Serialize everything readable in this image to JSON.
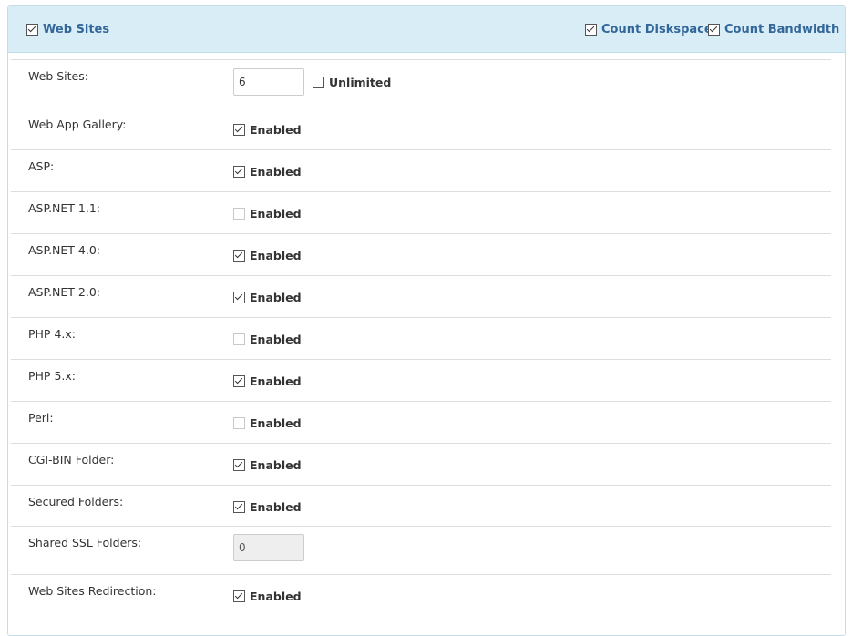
{
  "header": {
    "title": "Web Sites",
    "title_checked": true,
    "count_diskspace": {
      "label": "Count Diskspace",
      "checked": true
    },
    "count_bandwidth": {
      "label": "Count Bandwidth",
      "checked": true
    }
  },
  "web_sites": {
    "label": "Web Sites:",
    "value": "6",
    "unlimited_label": "Unlimited",
    "unlimited_checked": false
  },
  "rows": [
    {
      "label": "Web App Gallery:",
      "text": "Enabled",
      "checked": true
    },
    {
      "label": "ASP:",
      "text": "Enabled",
      "checked": true
    },
    {
      "label": "ASP.NET 1.1:",
      "text": "Enabled",
      "checked": false
    },
    {
      "label": "ASP.NET 4.0:",
      "text": "Enabled",
      "checked": true
    },
    {
      "label": "ASP.NET 2.0:",
      "text": "Enabled",
      "checked": true
    },
    {
      "label": "PHP 4.x:",
      "text": "Enabled",
      "checked": false
    },
    {
      "label": "PHP 5.x:",
      "text": "Enabled",
      "checked": true
    },
    {
      "label": "Perl:",
      "text": "Enabled",
      "checked": false
    },
    {
      "label": "CGI-BIN Folder:",
      "text": "Enabled",
      "checked": true
    },
    {
      "label": "Secured Folders:",
      "text": "Enabled",
      "checked": true
    }
  ],
  "shared_ssl": {
    "label": "Shared SSL Folders:",
    "value": "0"
  },
  "redirection": {
    "label": "Web Sites Redirection:",
    "text": "Enabled",
    "checked": true
  }
}
